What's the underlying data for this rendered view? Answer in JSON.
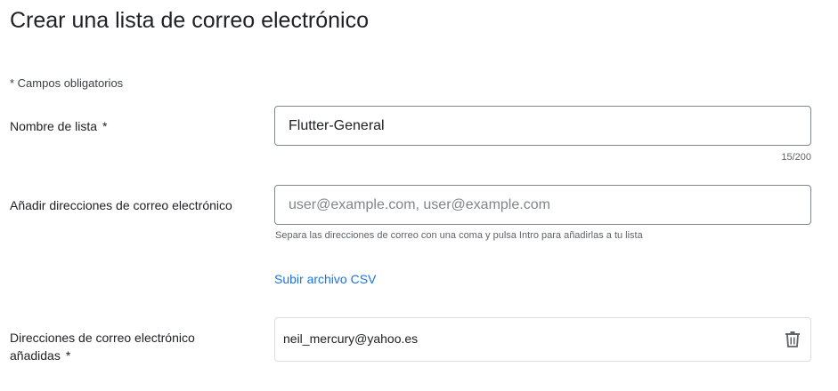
{
  "page": {
    "title": "Crear una lista de correo electrónico",
    "required_note": "* Campos obligatorios"
  },
  "list_name": {
    "label": "Nombre de lista",
    "required_marker": "*",
    "value": "Flutter-General",
    "counter": "15/200"
  },
  "add_emails": {
    "label": "Añadir direcciones de correo electrónico",
    "placeholder": "user@example.com, user@example.com",
    "hint": "Separa las direcciones de correo con una coma y pulsa Intro para añadirlas a tu lista",
    "upload_label": "Subir archivo CSV"
  },
  "added_emails": {
    "label": "Direcciones de correo electrónico añadidas",
    "required_marker": "*",
    "items": [
      {
        "email": "neil_mercury@yahoo.es",
        "action_icon": "trash-icon"
      }
    ]
  },
  "colors": {
    "link": "#1a73e8",
    "text": "#202124",
    "muted": "#5f6368",
    "input_border": "#80868b",
    "chip_border": "#dadce0"
  }
}
